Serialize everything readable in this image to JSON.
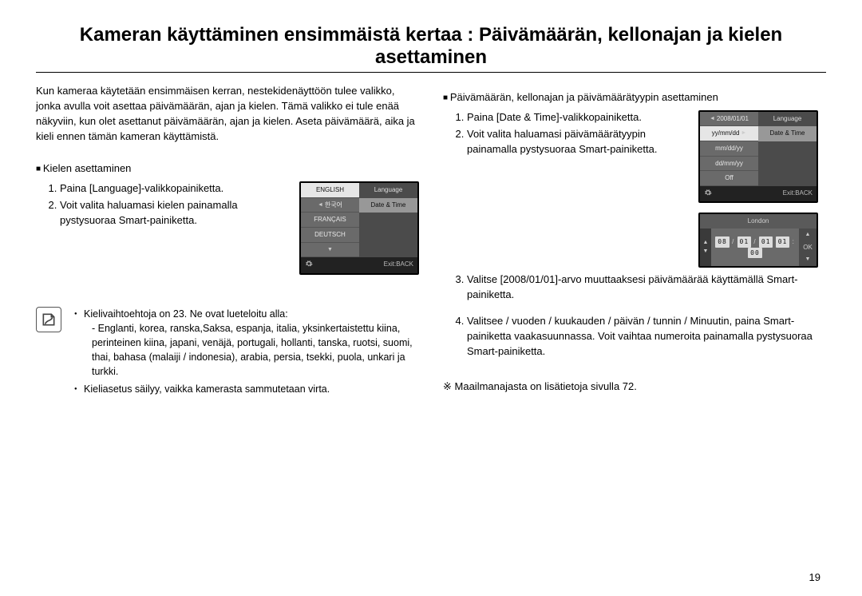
{
  "title": "Kameran käyttäminen ensimmäistä kertaa : Päivämäärän, kellonajan ja kielen asettaminen",
  "intro": "Kun kameraa käytetään ensimmäisen kerran, nestekidenäyttöön tulee valikko, jonka avulla voit asettaa päivämäärän, ajan ja kielen. Tämä valikko ei tule enää näkyviin, kun olet asettanut päivämäärän, ajan ja kielen. Aseta päivämäärä, aika ja kieli ennen tämän kameran käyttämistä.",
  "lang": {
    "heading": "Kielen asettaminen",
    "step1": "Paina [Language]-valikkopainiketta.",
    "step2": "Voit valita haluamasi kielen painamalla pystysuoraa Smart-painiketta."
  },
  "note": {
    "line1": "Kielivaihtoehtoja on 23. Ne ovat lueteloitu alla:",
    "line1sub": "- Englanti, korea, ranska,Saksa, espanja, italia, yksinkertaistettu kiina, perinteinen kiina, japani, venäjä, portugali, hollanti, tanska, ruotsi, suomi, thai, bahasa (malaiji / indonesia), arabia, persia, tsekki, puola, unkari ja turkki.",
    "line2": "Kieliasetus säilyy, vaikka kamerasta sammutetaan virta."
  },
  "dt": {
    "heading": "Päivämäärän, kellonajan ja päivämäärätyypin asettaminen",
    "step1": "Paina [Date & Time]-valikkopainiketta.",
    "step2": "Voit valita haluamasi päivämäärätyypin painamalla pystysuoraa Smart-painiketta.",
    "step3": "Valitse [2008/01/01]-arvo muuttaaksesi päivämäärää käyttämällä Smart-painiketta.",
    "step4": "Valitsee / vuoden / kuukauden / päivän / tunnin / Minuutin, paina Smart-painiketta vaakasuunnassa. Voit vaihtaa numeroita painamalla pystysuoraa Smart-painiketta."
  },
  "crossnote": "Maailmanajasta on lisätietoja sivulla 72.",
  "pagenum": "19",
  "lcdLang": {
    "items": [
      "ENGLISH",
      "한국어",
      "FRANÇAIS",
      "DEUTSCH"
    ],
    "rightTop": "Language",
    "rightHi": "Date & Time",
    "exit": "Exit:BACK"
  },
  "lcdDate": {
    "leftTop": "2008/01/01",
    "items": [
      "yy/mm/dd",
      "mm/dd/yy",
      "dd/mm/yy",
      "Off"
    ],
    "rightTop": "Language",
    "rightHi": "Date & Time",
    "exit": "Exit:BACK"
  },
  "lcdNum": {
    "head": "London",
    "digits": "08 / 01 / 01  01 : 00",
    "ok": "OK"
  }
}
